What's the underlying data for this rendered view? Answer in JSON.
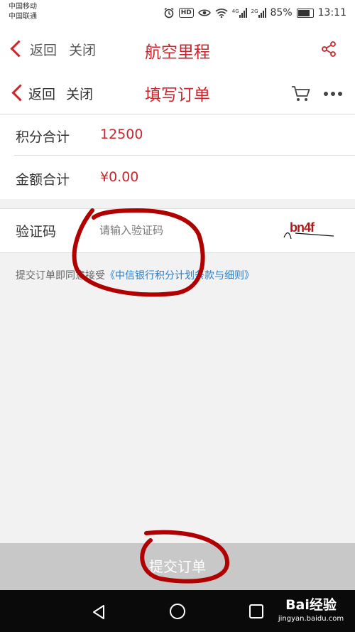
{
  "status_bar": {
    "carrier1": "中国移动",
    "carrier2": "中国联通",
    "hd_label": "HD",
    "net1": "4G",
    "net2": "2G",
    "battery": "85%",
    "time": "13:11"
  },
  "outer_nav": {
    "back": "返回",
    "close": "关闭",
    "title": "航空里程",
    "share_icon": "share-icon"
  },
  "inner_nav": {
    "back": "返回",
    "close": "关闭",
    "title": "填写订单",
    "cart_icon": "cart-icon",
    "more_icon": "more-icon"
  },
  "points_total": {
    "label": "积分合计",
    "value": "12500"
  },
  "amount_total": {
    "label": "金额合计",
    "value": "¥0.00"
  },
  "captcha": {
    "label": "验证码",
    "placeholder": "请输入验证码",
    "image_text": "bn4f"
  },
  "notice": {
    "text": "提交订单即同意接受",
    "link": "《中信银行积分计划条款与细则》"
  },
  "submit_label": "提交订单",
  "watermark": {
    "brand": "Bai经验",
    "url": "jingyan.baidu.com"
  },
  "colors": {
    "accent": "#c8262c",
    "link": "#2a7fc8",
    "submit_bg": "#c8c8c8",
    "annotation": "#b00000"
  }
}
